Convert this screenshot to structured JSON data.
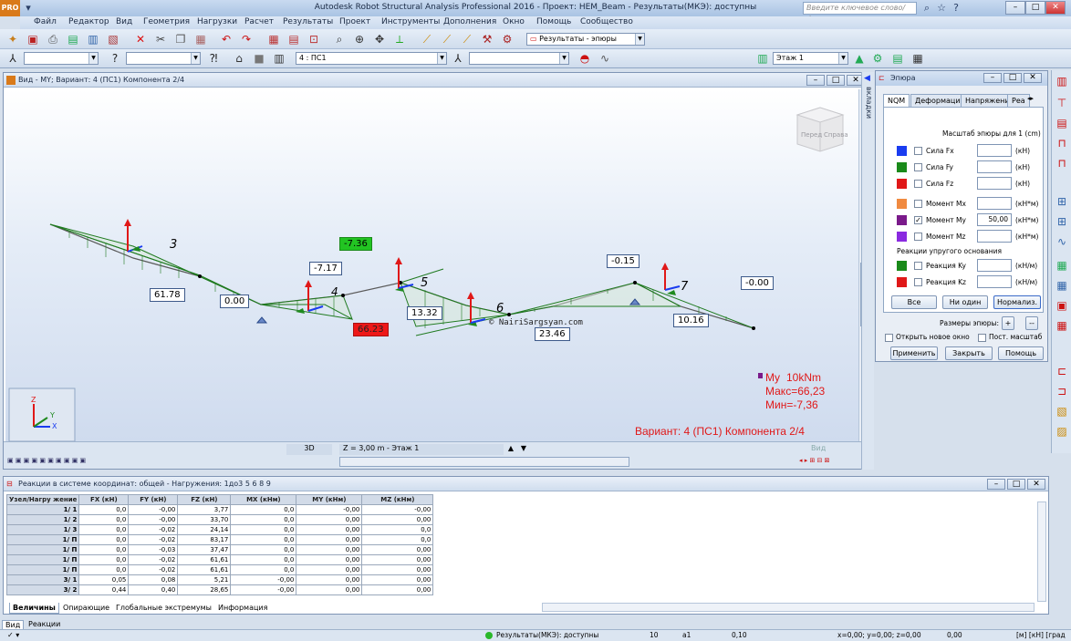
{
  "window": {
    "title": "Autodesk Robot Structural Analysis Professional 2016 - Проект: HEM_Beam - Результаты(МКЭ): доступны",
    "logo": "PRO",
    "search_placeholder": "Введите ключевое слово/фразу"
  },
  "menu": [
    "Файл",
    "Редактор",
    "Вид",
    "Геометрия",
    "Нагрузки",
    "Расчет",
    "Результаты",
    "Проект",
    "Инструменты",
    "Дополнения",
    "Окно",
    "Помощь",
    "Сообщество"
  ],
  "toolbar": {
    "results_combo": "Результаты - эпюры",
    "case_combo": "4 : ПС1",
    "storey_combo": "Этаж 1"
  },
  "view": {
    "title": "Вид - MY; Вариант: 4 (ПС1) Компонента 2/4",
    "cube_left": "Перед",
    "cube_right": "Справа",
    "legend": {
      "component": "My",
      "scale": "10kNm",
      "max": "Макс=66,23",
      "min": "Мин=-7,36"
    },
    "variant": "Вариант: 4 (ПС1) Компонента 2/4",
    "watermark": "© NairiSargsyan.com",
    "mode_3d": "3D",
    "z_level": "Z = 3,00 m - Этаж 1",
    "vid_label": "Вид",
    "nodes": [
      "3",
      "4",
      "5",
      "6",
      "7"
    ],
    "values": {
      "v1": "61.78",
      "v2": "0.00",
      "v3": "-7.17",
      "v4": "-7.36",
      "v5": "66.23",
      "v6": "13.32",
      "v7": "23.46",
      "v8": "-0.15",
      "v9": "10.16",
      "v10": "-0.00"
    },
    "axes": {
      "z": "Z",
      "y": "Y",
      "x": "X"
    }
  },
  "tabs_strip_label": "вкладки",
  "epura": {
    "title": "Эпюра",
    "tabs": [
      "NQM",
      "Деформация",
      "Напряжения",
      "Реа"
    ],
    "scale_label": "Масштаб эпюры для 1  (cm)",
    "rows": [
      {
        "label": "Сила Fx",
        "unit": "(кН)",
        "value": "",
        "checked": false,
        "color": "#1a3cf0"
      },
      {
        "label": "Сила Fy",
        "unit": "(кН)",
        "value": "",
        "checked": false,
        "color": "#1a8a1a"
      },
      {
        "label": "Сила Fz",
        "unit": "(кН)",
        "value": "",
        "checked": false,
        "color": "#e01818"
      },
      {
        "label": "Момент Mx",
        "unit": "(кН*м)",
        "value": "",
        "checked": false,
        "color": "#f08a40"
      },
      {
        "label": "Момент My",
        "unit": "(кН*м)",
        "value": "50,00",
        "checked": true,
        "color": "#7a1a8a"
      },
      {
        "label": "Момент Mz",
        "unit": "(кН*м)",
        "value": "",
        "checked": false,
        "color": "#8a2ae0"
      }
    ],
    "elastic_label": "Реакции упругого основания",
    "elastic_rows": [
      {
        "label": "Реакция Ky",
        "unit": "(кН/м)",
        "value": "",
        "color": "#1a8a1a"
      },
      {
        "label": "Реакция Kz",
        "unit": "(кН/м)",
        "value": "",
        "color": "#e01818"
      }
    ],
    "btn_all": "Все",
    "btn_none": "Ни один",
    "btn_normalize": "Нормализ.",
    "sizes_label": "Размеры эпюры:",
    "plus": "+",
    "minus": "--",
    "open_new": "Открыть новое окно",
    "const_scale": "Пост. масштаб",
    "apply": "Применить",
    "close": "Закрыть",
    "help": "Помощь"
  },
  "table": {
    "title": "Реакции в системе координат: общей - Нагружения: 1до3 5 6 8 9",
    "headers": [
      "Узел/Нагру жение",
      "FX (кН)",
      "FY (кН)",
      "FZ (кН)",
      "MX (кНм)",
      "MY (кНм)",
      "MZ (кНм)"
    ],
    "rows": [
      [
        "1/",
        "1",
        "0,0",
        "-0,00",
        "3,77",
        "0,0",
        "-0,00",
        "-0,00"
      ],
      [
        "1/",
        "2",
        "0,0",
        "-0,00",
        "33,70",
        "0,0",
        "0,00",
        "0,00"
      ],
      [
        "1/",
        "3",
        "0,0",
        "-0,02",
        "24,14",
        "0,0",
        "0,00",
        "0,0"
      ],
      [
        "1/",
        "П",
        "0,0",
        "-0,02",
        "83,17",
        "0,0",
        "0,00",
        "0,0"
      ],
      [
        "1/",
        "П",
        "0,0",
        "-0,03",
        "37,47",
        "0,0",
        "0,00",
        "0,00"
      ],
      [
        "1/",
        "П",
        "0,0",
        "-0,02",
        "61,61",
        "0,0",
        "0,00",
        "0,00"
      ],
      [
        "1/",
        "П",
        "0,0",
        "-0,02",
        "61,61",
        "0,0",
        "0,00",
        "0,00"
      ],
      [
        "3/",
        "1",
        "0,05",
        "0,08",
        "5,21",
        "-0,00",
        "0,00",
        "0,00"
      ],
      [
        "3/",
        "2",
        "0,44",
        "0,40",
        "28,65",
        "-0,00",
        "0,00",
        "0,00"
      ]
    ],
    "tabs": [
      "Величины",
      "Опирающие",
      "Глобальные экстремумы",
      "Информация"
    ]
  },
  "bottom_tabs": [
    "Вид",
    "Реакции"
  ],
  "status": {
    "results": "Результаты(МКЭ): доступны",
    "n1": "10",
    "n2": "1",
    "n3": "0,10",
    "coords": "x=0,00; y=0,00; z=0,00",
    "n4": "0,00",
    "units": "[м] [кН] [град"
  }
}
